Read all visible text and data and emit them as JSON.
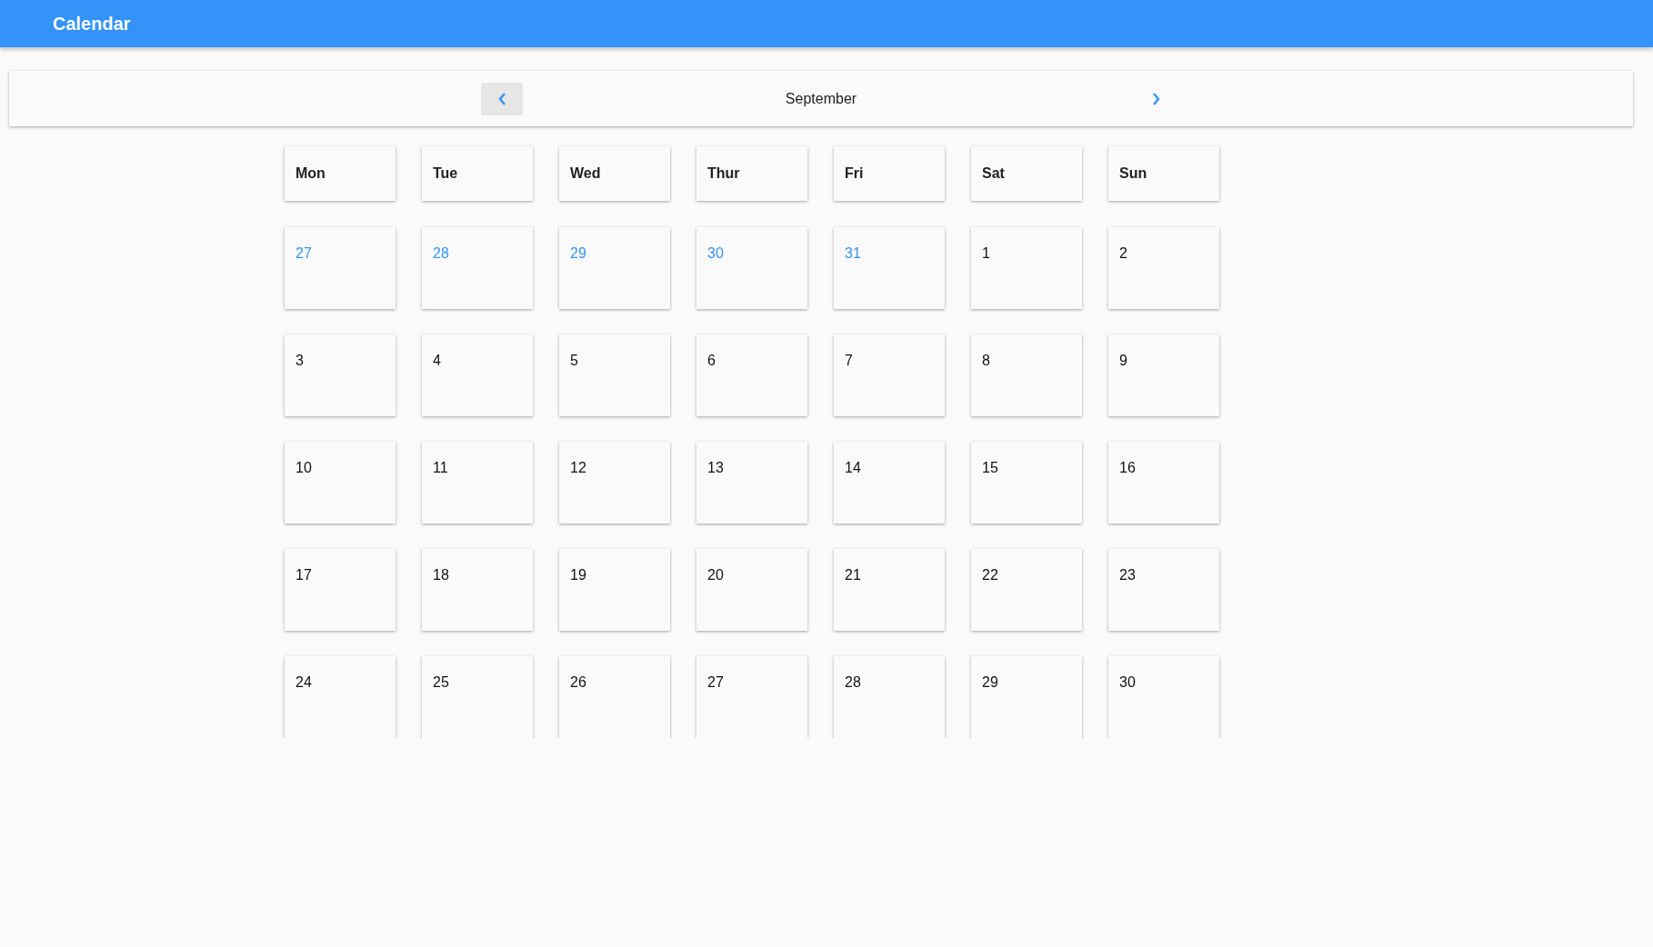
{
  "app_bar": {
    "title": "Calendar"
  },
  "month_nav": {
    "month": "September"
  },
  "weekdays": [
    "Mon",
    "Tue",
    "Wed",
    "Thur",
    "Fri",
    "Sat",
    "Sun"
  ],
  "weeks": [
    [
      {
        "day": "27",
        "other_month": true
      },
      {
        "day": "28",
        "other_month": true
      },
      {
        "day": "29",
        "other_month": true
      },
      {
        "day": "30",
        "other_month": true
      },
      {
        "day": "31",
        "other_month": true
      },
      {
        "day": "1",
        "other_month": false
      },
      {
        "day": "2",
        "other_month": false
      }
    ],
    [
      {
        "day": "3",
        "other_month": false
      },
      {
        "day": "4",
        "other_month": false
      },
      {
        "day": "5",
        "other_month": false
      },
      {
        "day": "6",
        "other_month": false
      },
      {
        "day": "7",
        "other_month": false
      },
      {
        "day": "8",
        "other_month": false
      },
      {
        "day": "9",
        "other_month": false
      }
    ],
    [
      {
        "day": "10",
        "other_month": false
      },
      {
        "day": "11",
        "other_month": false
      },
      {
        "day": "12",
        "other_month": false
      },
      {
        "day": "13",
        "other_month": false
      },
      {
        "day": "14",
        "other_month": false
      },
      {
        "day": "15",
        "other_month": false
      },
      {
        "day": "16",
        "other_month": false
      }
    ],
    [
      {
        "day": "17",
        "other_month": false
      },
      {
        "day": "18",
        "other_month": false
      },
      {
        "day": "19",
        "other_month": false
      },
      {
        "day": "20",
        "other_month": false
      },
      {
        "day": "21",
        "other_month": false
      },
      {
        "day": "22",
        "other_month": false
      },
      {
        "day": "23",
        "other_month": false
      }
    ],
    [
      {
        "day": "24",
        "other_month": false
      },
      {
        "day": "25",
        "other_month": false
      },
      {
        "day": "26",
        "other_month": false
      },
      {
        "day": "27",
        "other_month": false
      },
      {
        "day": "28",
        "other_month": false
      },
      {
        "day": "29",
        "other_month": false
      },
      {
        "day": "30",
        "other_month": false
      }
    ]
  ]
}
